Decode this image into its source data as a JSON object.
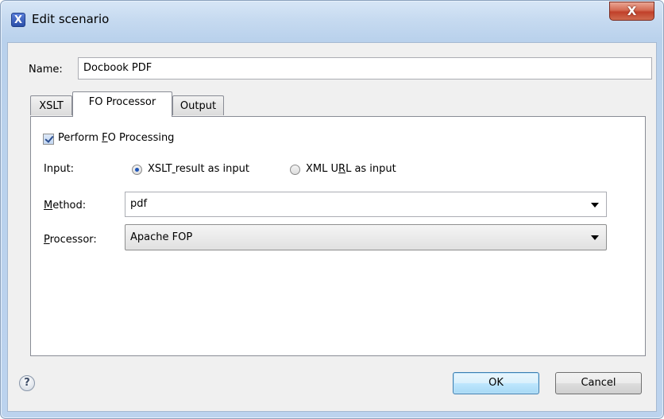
{
  "window": {
    "title": "Edit scenario",
    "app_icon_glyph": "X",
    "close_glyph": "X"
  },
  "name_field": {
    "label": "Name:",
    "value": "Docbook PDF"
  },
  "tabs": [
    {
      "label": "XSLT",
      "active": false
    },
    {
      "label": "FO Processor",
      "active": true
    },
    {
      "label": "Output",
      "active": false
    }
  ],
  "fo_panel": {
    "perform_checkbox": {
      "label_pre": "Perform ",
      "label_mnemonic": "F",
      "label_post": "O Processing",
      "checked": true
    },
    "input_label": "Input:",
    "radio_xslt": {
      "label_pre": "XSLT",
      "label_mnemonic": " ",
      "label_post": "result as input",
      "selected": true
    },
    "radio_xml": {
      "label_pre": "XML U",
      "label_mnemonic": "R",
      "label_post": "L as input",
      "selected": false
    },
    "method": {
      "label_mnemonic": "M",
      "label_rest": "ethod:",
      "value": "pdf"
    },
    "processor": {
      "label_mnemonic": "P",
      "label_rest": "rocessor:",
      "value": "Apache FOP"
    }
  },
  "footer": {
    "help_glyph": "?",
    "ok_label": "OK",
    "cancel_label": "Cancel"
  },
  "icons": [
    "app-logo-icon",
    "close-icon",
    "help-icon",
    "dropdown-arrow-icon"
  ]
}
